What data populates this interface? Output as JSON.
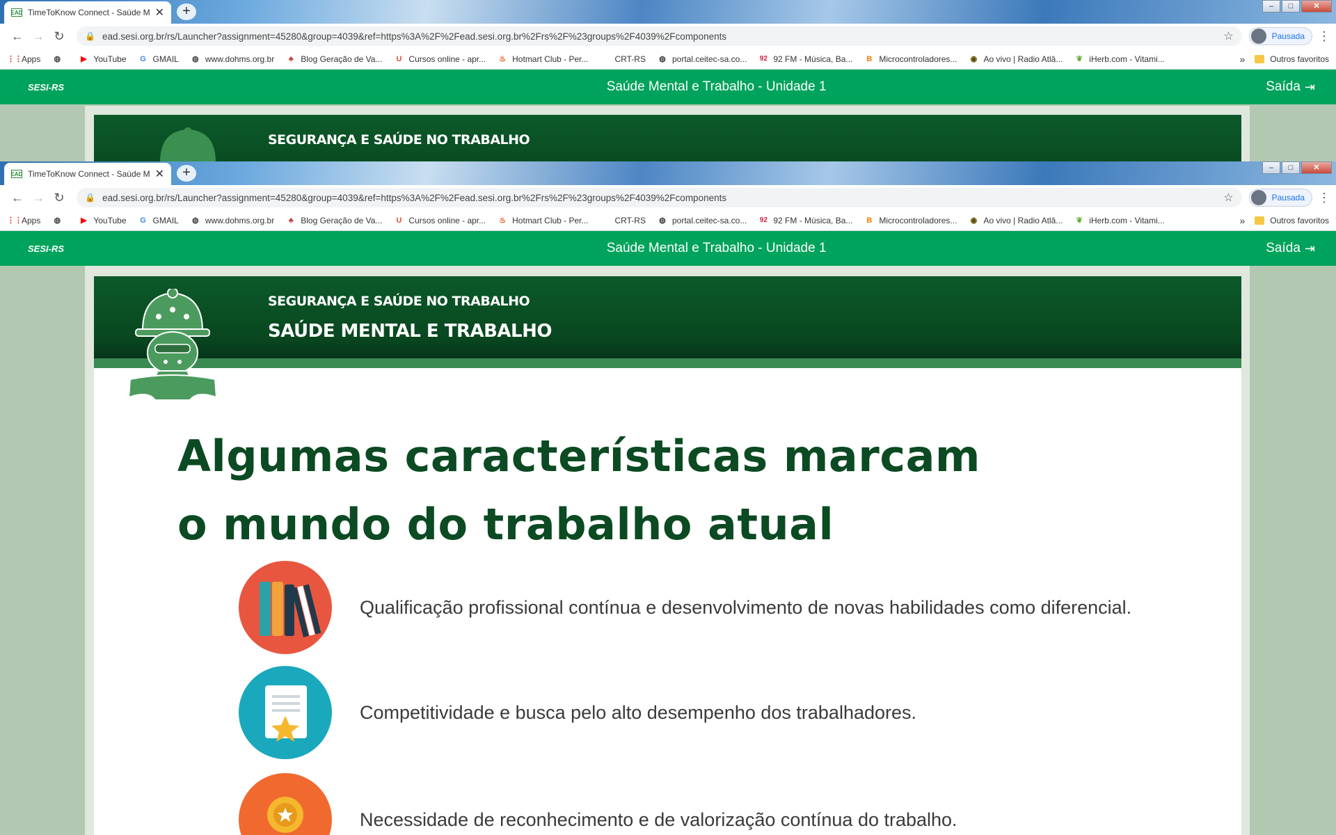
{
  "browser": {
    "tab_title": "TimeToKnow Connect - Saúde M",
    "tab_favicon": "EAD",
    "url": "ead.sesi.org.br/rs/Launcher?assignment=45280&group=4039&ref=https%3A%2F%2Fead.sesi.org.br%2Frs%2F%23groups%2F4039%2Fcomponents",
    "profile_label": "Pausada",
    "bookmarks": [
      {
        "label": "Apps",
        "icon": "apps-icon"
      },
      {
        "label": "",
        "icon": "globe-icon"
      },
      {
        "label": "YouTube",
        "icon": "youtube-icon"
      },
      {
        "label": "GMAIL",
        "icon": "google-icon"
      },
      {
        "label": "www.dohms.org.br",
        "icon": "globe-icon"
      },
      {
        "label": "Blog Geração de Va...",
        "icon": "blog-icon"
      },
      {
        "label": "Cursos online - apr...",
        "icon": "cursos-icon"
      },
      {
        "label": "Hotmart Club - Per...",
        "icon": "hotmart-icon"
      },
      {
        "label": "CRT-RS",
        "icon": "crt-icon"
      },
      {
        "label": "portal.ceitec-sa.co...",
        "icon": "globe-icon"
      },
      {
        "label": "92 FM - Música, Ba...",
        "icon": "radio92-icon"
      },
      {
        "label": "Microcontroladores...",
        "icon": "blogger-icon"
      },
      {
        "label": "Ao vivo | Radio Atlâ...",
        "icon": "radio-icon"
      },
      {
        "label": "iHerb.com - Vitami...",
        "icon": "iherb-icon"
      }
    ],
    "bookmarks_more": "»",
    "other_bookmarks": "Outros favoritos",
    "icon_92": "92"
  },
  "app": {
    "brand": "SESI-RS",
    "course_title": "Saúde Mental e Trabalho - Unidade 1",
    "exit_label": "Saída"
  },
  "banner": {
    "subtitle": "SEGURANÇA E SAÚDE NO TRABALHO",
    "title": "SAÚDE MENTAL E TRABALHO"
  },
  "content": {
    "headline_line1": "Algumas características marcam",
    "headline_line2": "o mundo do trabalho atual",
    "items": [
      {
        "text": "Qualificação profissional contínua e desenvolvimento de novas habilidades como diferencial.",
        "icon": "books-icon",
        "color": "#e8563f"
      },
      {
        "text": "Competitividade e busca pelo alto desempenho dos trabalhadores.",
        "icon": "certificate-star-icon",
        "color": "#1aa8bd"
      },
      {
        "text": "Necessidade de reconhecimento e de valorização contínua do trabalho.",
        "icon": "medal-icon",
        "color": "#f06a30"
      }
    ]
  },
  "colors": {
    "header_green": "#00a35b",
    "banner_green": "#0c5a2a",
    "headline_green": "#0b4a22"
  }
}
